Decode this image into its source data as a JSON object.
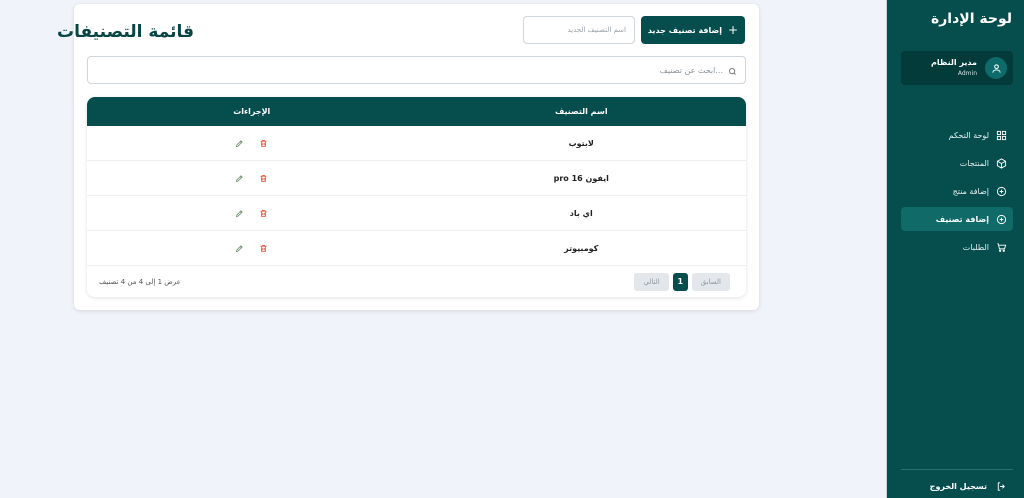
{
  "sidebar": {
    "title": "لوحة الإدارة",
    "user": {
      "name": "مدير النظام",
      "role": "Admin"
    },
    "items": [
      {
        "label": "لوحة التحكم",
        "icon": "dashboard-icon",
        "active": false
      },
      {
        "label": "المنتجات",
        "icon": "box-icon",
        "active": false
      },
      {
        "label": "إضافة منتج",
        "icon": "plus-circle-icon",
        "active": false
      },
      {
        "label": "إضافة تصنيف",
        "icon": "plus-circle-icon",
        "active": true
      },
      {
        "label": "الطلبات",
        "icon": "cart-icon",
        "active": false
      }
    ],
    "logout": "تسجيل الخروج"
  },
  "main": {
    "title": "قائمة التصنيفات",
    "add_button": "إضافة تصنيف جديد",
    "name_input_placeholder": "اسم التصنيف الجديد",
    "search_placeholder": "...ابحث عن تصنيف"
  },
  "table": {
    "headers": {
      "name": "اسم التصنيف",
      "actions": "الإجراءات"
    },
    "rows": [
      {
        "name": "لابتوب"
      },
      {
        "name": "ايفون 16 pro"
      },
      {
        "name": "اي باد"
      },
      {
        "name": "كومبيوتر"
      }
    ],
    "footer": "عرض 1 إلى 4 من 4 تصنيف",
    "pagination": {
      "prev": "السابق",
      "next": "التالي",
      "current": "1"
    }
  },
  "colors": {
    "brand": "#064e4e",
    "edit": "#6b8a6b",
    "delete": "#e0523a"
  }
}
